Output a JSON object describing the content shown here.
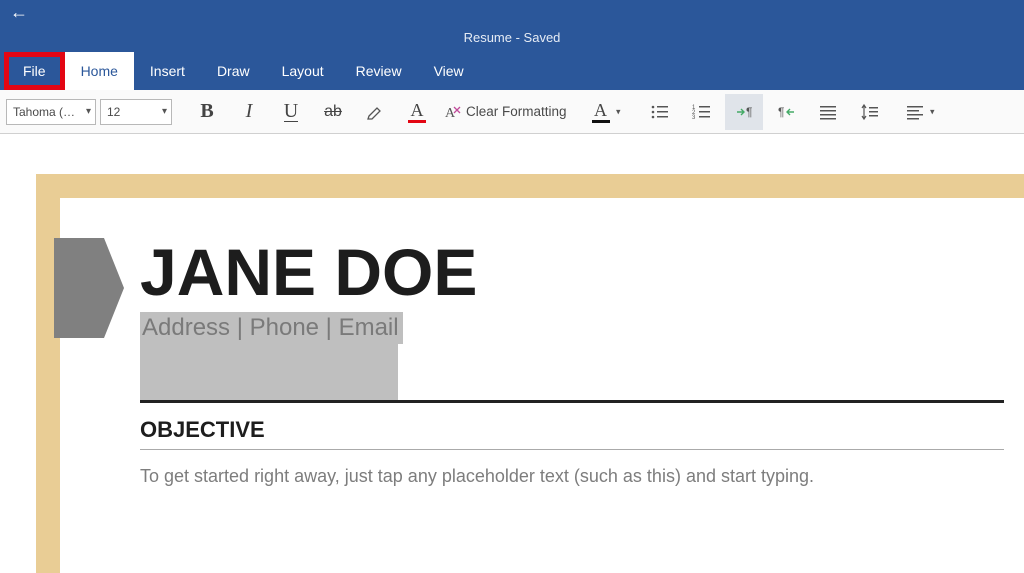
{
  "title": "Resume - Saved",
  "tabs": {
    "file": "File",
    "home": "Home",
    "insert": "Insert",
    "draw": "Draw",
    "layout": "Layout",
    "review": "Review",
    "view": "View"
  },
  "ribbon": {
    "font_name": "Tahoma (…",
    "font_size": "12",
    "clear_formatting": "Clear Formatting"
  },
  "doc": {
    "name": "JANE DOE",
    "contact": "Address | Phone | Email",
    "section": "OBJECTIVE",
    "body": "To get started right away, just tap any placeholder text (such as this) and start typing."
  }
}
